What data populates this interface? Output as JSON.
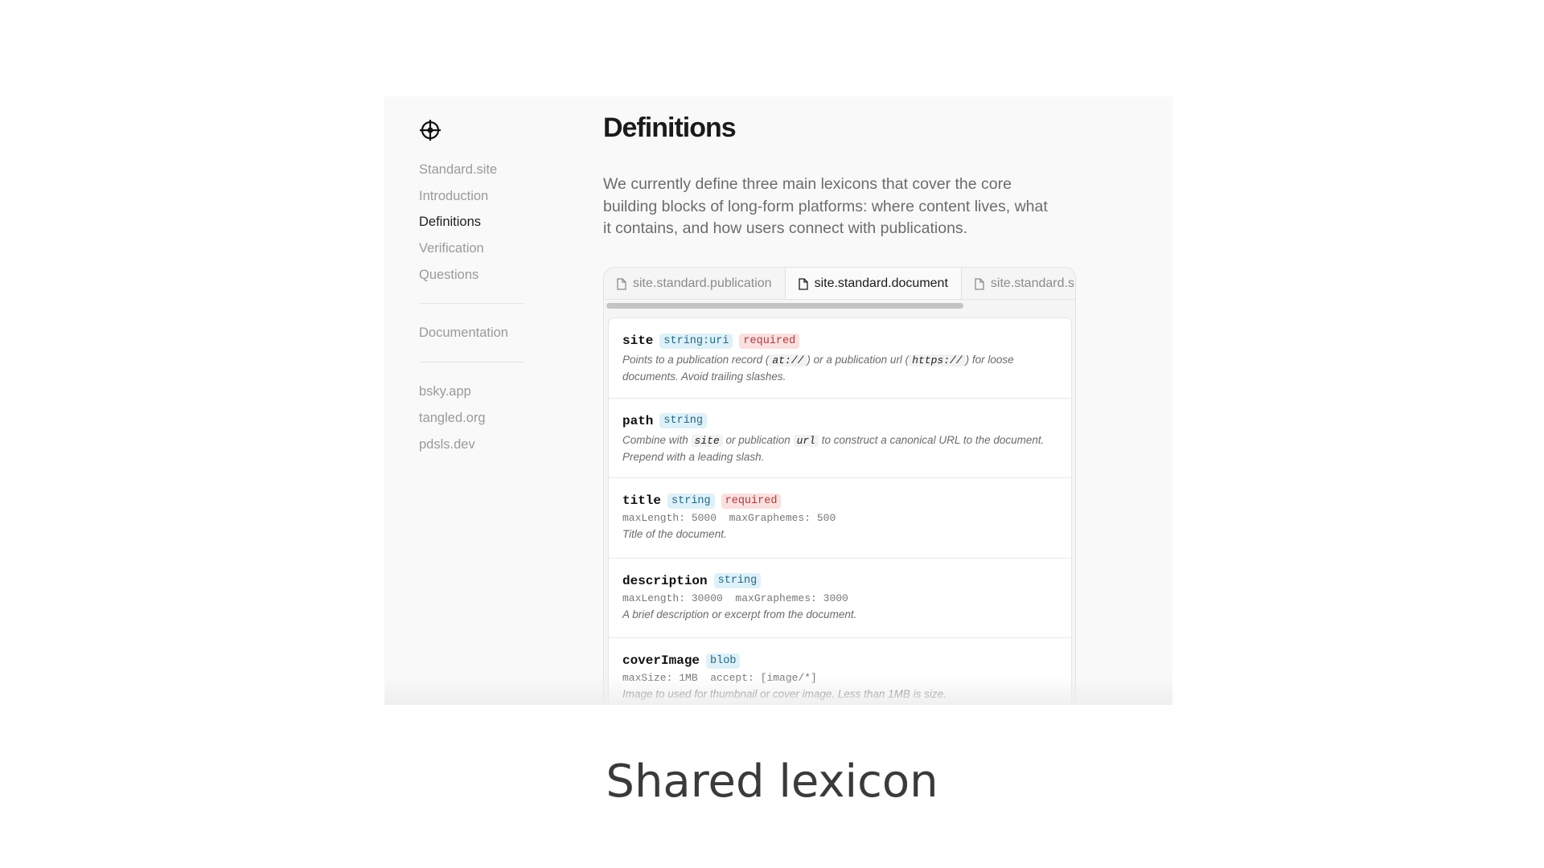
{
  "sidebar": {
    "logo_icon": "standard-site-logo",
    "nav_primary": [
      "Standard.site",
      "Introduction",
      "Definitions",
      "Verification",
      "Questions"
    ],
    "active_item": "Definitions",
    "nav_docs": [
      "Documentation"
    ],
    "nav_links": [
      "bsky.app",
      "tangled.org",
      "pdsls.dev"
    ]
  },
  "main": {
    "title": "Definitions",
    "intro": "We currently define three main lexicons that cover the core building blocks of long-form platforms: where content lives, what it contains, and how users connect with publications.",
    "tabs": [
      {
        "label": "site.standard.publication",
        "icon": "file-icon"
      },
      {
        "label": "site.standard.document",
        "icon": "file-icon",
        "active": true
      },
      {
        "label": "site.standard.subscription",
        "icon": "file-icon"
      }
    ],
    "fields": [
      {
        "name": "site",
        "type": "string:uri",
        "required": "required",
        "desc_parts": [
          "Points to a publication record (",
          "at://",
          ") or a publication url (",
          "https://",
          ") for loose documents. Avoid trailing slashes."
        ]
      },
      {
        "name": "path",
        "type": "string",
        "desc_parts": [
          "Combine with ",
          "site",
          " or publication ",
          "url",
          " to construct a canonical URL to the document. Prepend with a leading slash."
        ]
      },
      {
        "name": "title",
        "type": "string",
        "required": "required",
        "meta": "maxLength: 5000  maxGraphemes: 500",
        "desc": "Title of the document."
      },
      {
        "name": "description",
        "type": "string",
        "meta": "maxLength: 30000  maxGraphemes: 3000",
        "desc": "A brief description or excerpt from the document."
      },
      {
        "name": "coverImage",
        "type": "blob",
        "meta": "maxSize: 1MB  accept: [image/*]",
        "desc": "Image to used for thumbnail or cover image. Less than 1MB is size."
      }
    ]
  },
  "caption": "Shared lexicon",
  "colors": {
    "background": "#f9f9f9",
    "type_badge": "#dff1f8",
    "required_badge": "#fbe0e0"
  }
}
